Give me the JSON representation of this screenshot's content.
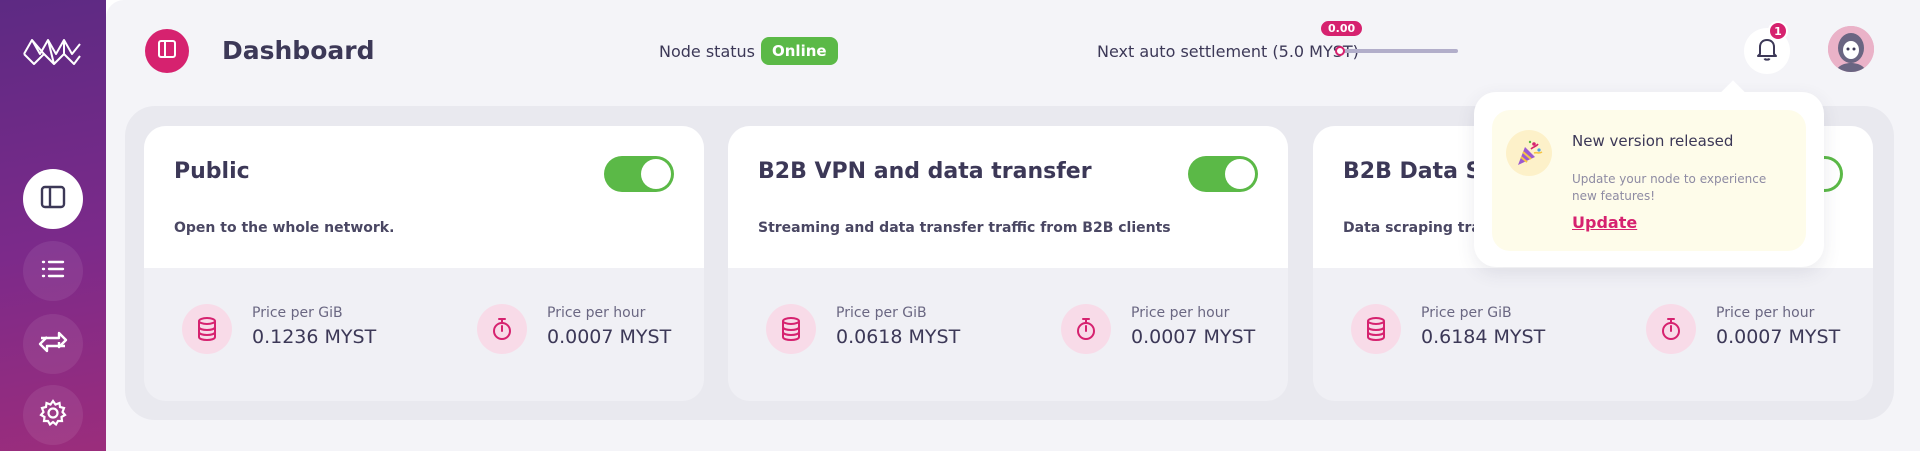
{
  "header": {
    "title": "Dashboard",
    "node_status_label": "Node status",
    "node_status": "Online",
    "settlement_label": "Next auto settlement (5.0 MYST)",
    "settlement_value": "0.00",
    "settlement_progress": 0.0,
    "notification_count": "1"
  },
  "cards": [
    {
      "title": "Public",
      "description": "Open to the whole network.",
      "enabled": true,
      "price_gib_label": "Price per GiB",
      "price_gib": "0.1236 MYST",
      "price_hour_label": "Price per hour",
      "price_hour": "0.0007 MYST"
    },
    {
      "title": "B2B VPN and data transfer",
      "description": "Streaming and data transfer traffic from B2B clients",
      "enabled": true,
      "price_gib_label": "Price per GiB",
      "price_gib": "0.0618 MYST",
      "price_hour_label": "Price per hour",
      "price_hour": "0.0007 MYST"
    },
    {
      "title": "B2B Data Sc",
      "description": "Data scraping traf",
      "enabled": true,
      "price_gib_label": "Price per GiB",
      "price_gib": "0.6184 MYST",
      "price_hour_label": "Price per hour",
      "price_hour": "0.0007 MYST"
    }
  ],
  "notification": {
    "title": "New version released",
    "body": "Update your node to experience new features!",
    "link": "Update"
  },
  "sidebar": {
    "items": [
      {
        "icon": "dashboard-icon",
        "active": true
      },
      {
        "icon": "list-icon",
        "active": false
      },
      {
        "icon": "transfer-icon",
        "active": false
      },
      {
        "icon": "gear-icon",
        "active": false
      }
    ]
  },
  "colors": {
    "accent": "#d6226f",
    "success": "#5bb947",
    "sidebar_start": "#5d2a83",
    "sidebar_end": "#9b2d7c"
  }
}
